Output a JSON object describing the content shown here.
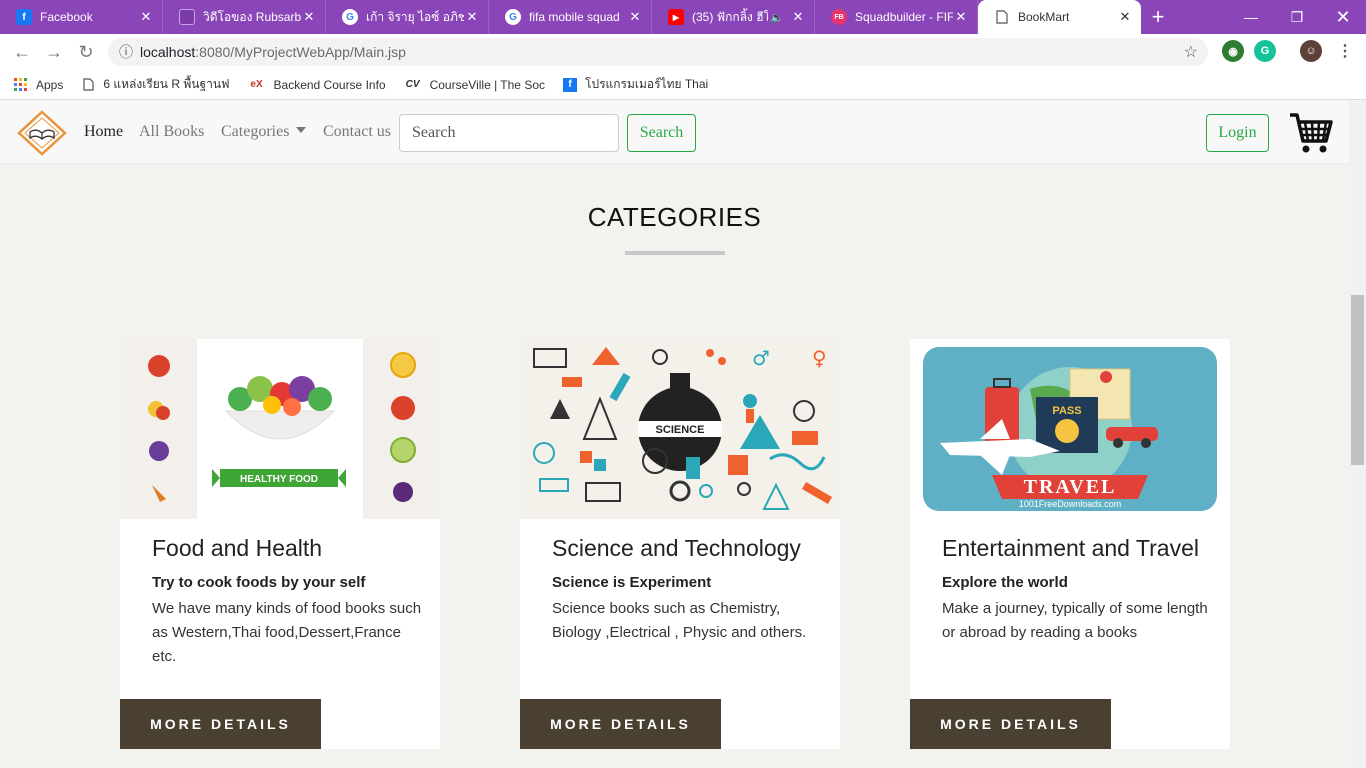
{
  "browser": {
    "tabs": [
      {
        "title": "Facebook",
        "favicon": "facebook-icon",
        "color": "#1877f2"
      },
      {
        "title": "วิดีโอของ Rubsarb -",
        "favicon": "twitch-icon",
        "color": "#9146ff"
      },
      {
        "title": "เก้า จิรายุ ไอซ์ อภิชฎ",
        "favicon": "google-icon",
        "color": "#ffffff"
      },
      {
        "title": "fifa mobile squad",
        "favicon": "google-icon",
        "color": "#ffffff"
      },
      {
        "title": "(35) ฟักกลิ้ง ฮีโ",
        "favicon": "youtube-icon",
        "color": "#ff0000"
      },
      {
        "title": "Squadbuilder - FIF",
        "favicon": "futbin-icon",
        "color": "#e8336d"
      },
      {
        "title": "BookMart",
        "favicon": "page-icon",
        "color": "#ffffff"
      }
    ],
    "url_host": "localhost",
    "url_path": ":8080/MyProjectWebApp/Main.jsp",
    "bookmarks": [
      {
        "label": "Apps",
        "icon": "apps-icon"
      },
      {
        "label": "6 แหล่งเรียน R พื้นฐานฟ",
        "icon": "page-icon"
      },
      {
        "label": "Backend Course Info",
        "icon": "edx-icon"
      },
      {
        "label": "CourseVille | The Soc",
        "icon": "courseville-icon"
      },
      {
        "label": "โปรแกรมเมอร์ไทย Thai",
        "icon": "facebook-icon"
      }
    ]
  },
  "site": {
    "nav": {
      "home": "Home",
      "all_books": "All Books",
      "categories": "Categories",
      "contact": "Contact us",
      "search_placeholder": "Search",
      "search_button": "Search",
      "login": "Login"
    },
    "section_title": "CATEGORIES",
    "cards": [
      {
        "title": "Food and Health",
        "subtitle": "Try to cook foods by your self",
        "description": "We have many kinds of food books such as Western,Thai food,Dessert,France etc.",
        "button": "MORE DETAILS",
        "image_label": "HEALTHY FOOD"
      },
      {
        "title": "Science and Technology",
        "subtitle": "Science is Experiment",
        "description": "Science books such as Chemistry, Biology ,Electrical , Physic and others.",
        "button": "MORE DETAILS",
        "image_label": "SCIENCE"
      },
      {
        "title": "Entertainment and Travel",
        "subtitle": "Explore the world",
        "description": "Make a journey, typically of some length or abroad by reading a books",
        "button": "MORE DETAILS",
        "image_label": "TRAVEL",
        "image_label2": "PASS",
        "image_label3": "1001FreeDownloads.com"
      }
    ]
  },
  "colors": {
    "chrome_purple": "#8a45b8",
    "accent_green": "#28a745",
    "button_brown": "#4a4031",
    "page_bg": "#f2f2ee"
  }
}
